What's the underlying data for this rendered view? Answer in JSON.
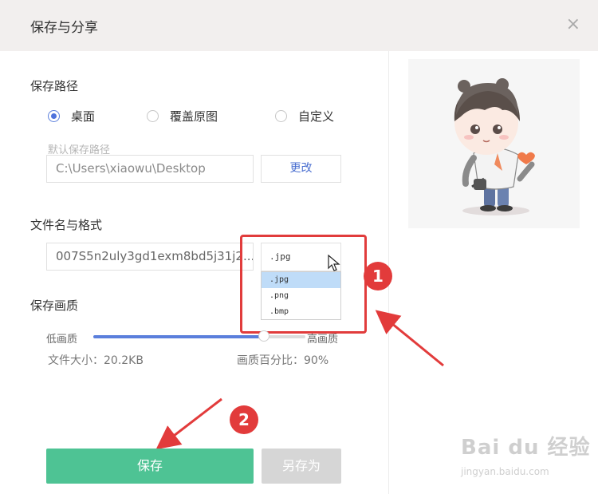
{
  "dialog": {
    "title": "保存与分享"
  },
  "close_label": "×",
  "save_path": {
    "label": "保存路径",
    "options": [
      "桌面",
      "覆盖原图",
      "自定义"
    ],
    "selected": "桌面",
    "hint": "默认保存路径",
    "path_value": "C:\\Users\\xiaowu\\Desktop",
    "change_label": "更改"
  },
  "file": {
    "label": "文件名与格式",
    "name_value": "007S5n2uly3gd1exm8bd5j31j2...",
    "format_selected": ".jpg",
    "format_options": [
      ".jpg",
      ".png",
      ".bmp"
    ],
    "highlighted_option": ".jpg"
  },
  "quality": {
    "label": "保存画质",
    "low_label": "低画质",
    "high_label": "高画质",
    "level": 0.8,
    "file_size": "文件大小：20.2KB",
    "percent_text": "画质百分比：90%"
  },
  "actions": {
    "save_label": "保存",
    "save_as_label": "另存为"
  },
  "annotations": {
    "badge1": "1",
    "badge2": "2",
    "accent": "#e23b3b"
  },
  "watermark": {
    "main": "Bai du 经验",
    "sub": "jingyan.baidu.com"
  },
  "colors": {
    "primary_green": "#4ec394",
    "accent_blue": "#5b7fdc",
    "disabled_gray": "#d6d6d6"
  }
}
